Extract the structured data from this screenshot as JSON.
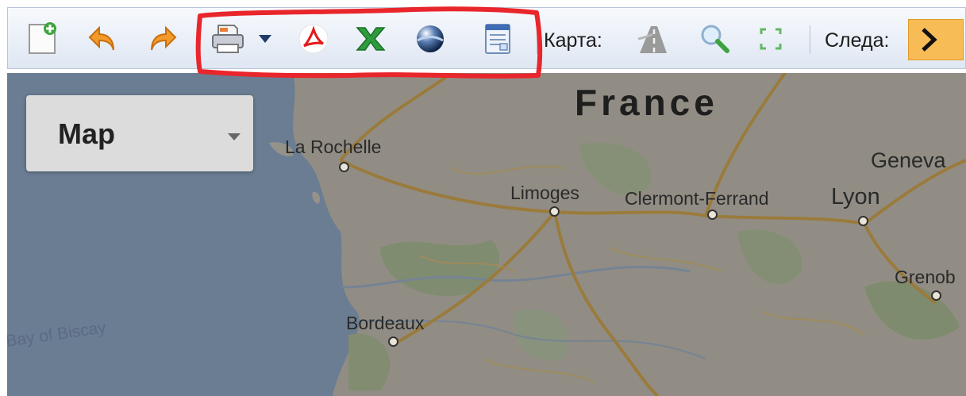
{
  "toolbar": {
    "buttons": [
      {
        "name": "new-document-icon"
      },
      {
        "name": "undo-icon"
      },
      {
        "name": "redo-icon"
      },
      {
        "name": "print-icon"
      },
      {
        "name": "dropdown-arrow-icon"
      },
      {
        "name": "pdf-icon"
      },
      {
        "name": "excel-icon"
      },
      {
        "name": "globe-icon"
      },
      {
        "name": "report-icon"
      },
      {
        "name": "road-icon"
      },
      {
        "name": "zoom-icon"
      },
      {
        "name": "fit-view-icon"
      },
      {
        "name": "chevron-right-icon"
      }
    ],
    "map_label": "Карта:",
    "tracks_label": "Следа:"
  },
  "colors": {
    "highlight": "#e8262b",
    "next_button": "#f7bc55",
    "water": "#a7c4e4",
    "land": "#e9e4d8"
  },
  "map": {
    "type_selector": "Map",
    "country": "France",
    "sea": "Bay of Biscay",
    "cities": [
      "La Rochelle",
      "Limoges",
      "Clermont-Ferrand",
      "Lyon",
      "Geneva",
      "Grenob",
      "Bordeaux"
    ]
  }
}
